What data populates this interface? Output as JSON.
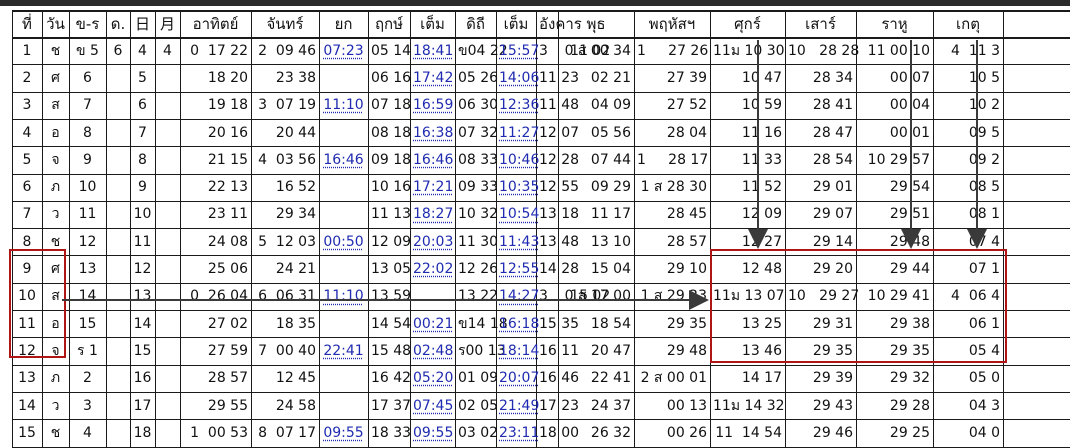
{
  "header": [
    "ที่",
    "วัน",
    "ข-ร",
    "ด.",
    "日",
    "月",
    "อาทิตย์",
    "จันทร์",
    "ยก",
    "ฤกษ์",
    "เต็ม",
    "ดิถี",
    "เต็ม",
    "อังคาร",
    "พุธ",
    "พฤหัสฯ",
    "ศุกร์",
    "เสาร์",
    "ราหู",
    "เกตุ"
  ],
  "rows": [
    [
      "1",
      "ช",
      "ข 5",
      "6",
      "4",
      "4",
      "0  17 22",
      "2  09 46",
      "07:23",
      "05 14",
      "18:41",
      "ข04 22",
      "15:57",
      "3     11 02",
      "0 ส 00 34",
      "1     27 26",
      "11ม 10 30",
      "10   28 28",
      "11 00 10",
      "4  11 3"
    ],
    [
      "2",
      "ศ",
      "6",
      "",
      "5",
      "",
      "18 20",
      "23 38",
      "",
      "06 16",
      "17:42",
      "05 26",
      "14:06",
      "11 23",
      "02 21",
      "27 39",
      "10 47",
      "28 34",
      "00 07",
      "10 5"
    ],
    [
      "3",
      "ส",
      "7",
      "",
      "6",
      "",
      "19 18",
      "3  07 19",
      "11:10",
      "07 18",
      "16:59",
      "06 30",
      "12:36",
      "11 48",
      "04 09",
      "27 52",
      "10 59",
      "28 41",
      "00 04",
      "10 2"
    ],
    [
      "4",
      "อ",
      "8",
      "",
      "7",
      "",
      "20 16",
      "20 44",
      "",
      "08 18",
      "16:38",
      "07 32",
      "11:27",
      "12 07",
      "05 56",
      "28 04",
      "11 16",
      "28 47",
      "00 01",
      "09 5"
    ],
    [
      "5",
      "จ",
      "9",
      "",
      "8",
      "",
      "21 15",
      "4  03 56",
      "16:46",
      "09 18",
      "16:46",
      "08 33",
      "10:46",
      "12 28",
      "07 44",
      "1     28 17",
      "11 33",
      "28 54",
      "10 29 57",
      "09 2"
    ],
    [
      "6",
      "ภ",
      "10",
      "",
      "9",
      "",
      "22 13",
      "16 52",
      "",
      "10 16",
      "17:21",
      "09 33",
      "10:35",
      "12 55",
      "09 29",
      "1 ส 28 30",
      "11 52",
      "29 01",
      "29 54",
      "08 5"
    ],
    [
      "7",
      "ว",
      "11",
      "",
      "10",
      "",
      "23 11",
      "29 34",
      "",
      "11 13",
      "18:27",
      "10 32",
      "10:54",
      "13 18",
      "11 17",
      "28 45",
      "12 09",
      "29 07",
      "29 51",
      "08 1"
    ],
    [
      "8",
      "ช",
      "12",
      "",
      "11",
      "",
      "24 08",
      "5  12 03",
      "00:50",
      "12 09",
      "20:03",
      "11 30",
      "11:43",
      "13 48",
      "13 10",
      "28 57",
      "12 27",
      "29 14",
      "29 48",
      "07 4"
    ],
    [
      "9",
      "ศ",
      "13",
      "",
      "12",
      "",
      "25 06",
      "24 21",
      "",
      "13 05",
      "22:02",
      "12 26",
      "12:55",
      "14 28",
      "15 04",
      "29 10",
      "12 48",
      "29 20",
      "29 44",
      "07 1"
    ],
    [
      "10",
      "ส",
      "14",
      "",
      "13",
      "",
      "0  26 04",
      "6  06 31",
      "11:10",
      "13 59",
      "",
      "13 22",
      "14:27",
      "3     15 02",
      "0 ส 17 00",
      "1 ส 29 23",
      "11ม 13 07",
      "10   29 27",
      "10 29 41",
      "4  06 4"
    ],
    [
      "11",
      "อ",
      "15",
      "",
      "14",
      "",
      "27 02",
      "18 35",
      "",
      "14 54",
      "00:21",
      "ข14 18",
      "16:18",
      "15 35",
      "18 54",
      "29 35",
      "13 25",
      "29 31",
      "29 38",
      "06 1"
    ],
    [
      "12",
      "จ",
      "ร 1",
      "",
      "15",
      "",
      "27 59",
      "7  00 40",
      "22:41",
      "15 48",
      "02:48",
      "ร00 13",
      "18:14",
      "16 11",
      "20 47",
      "29 48",
      "13 46",
      "29 35",
      "29 35",
      "05 4"
    ],
    [
      "13",
      "ภ",
      "2",
      "",
      "16",
      "",
      "28 57",
      "12 45",
      "",
      "16 42",
      "05:20",
      "01 09",
      "20:07",
      "16 46",
      "22 41",
      "2 ส 00 01",
      "14 17",
      "29 39",
      "29 32",
      "05 0"
    ],
    [
      "14",
      "ว",
      "3",
      "",
      "17",
      "",
      "29 55",
      "24 58",
      "",
      "17 37",
      "07:45",
      "02 05",
      "21:49",
      "17 23",
      "24 37",
      "00 13",
      "11ม 14 32",
      "29 43",
      "29 28",
      "04 3"
    ],
    [
      "15",
      "ช",
      "4",
      "",
      "18",
      "",
      "1  00 53",
      "8  07 17",
      "09:55",
      "18 33",
      "09:55",
      "03 02",
      "23:11",
      "18 00",
      "26 32",
      "00 26",
      "11  14 54",
      "29 46",
      "29 25",
      "04 0"
    ]
  ],
  "accent": {
    "line": "#1a1a1a",
    "highlight_box": "#b01515",
    "arrow": "#3a3a3a",
    "time_blue": "#1f2bb0"
  }
}
